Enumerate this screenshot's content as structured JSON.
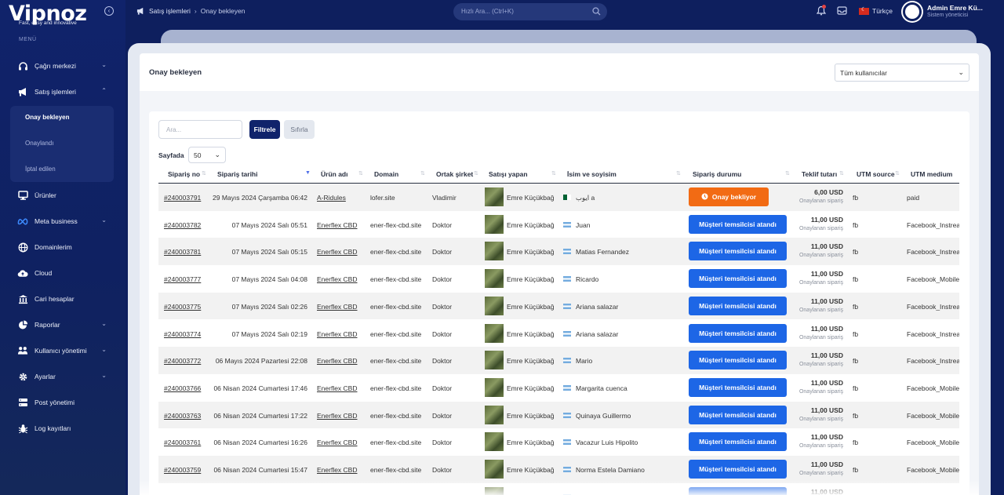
{
  "brand": {
    "name": "Vipnoz",
    "tagline": "Fast, easy and innovative"
  },
  "sidebar": {
    "menu_title": "MENÜ",
    "items": [
      {
        "label": "Çağrı merkezi",
        "icon": "headset-icon",
        "chevron": "⌄"
      },
      {
        "label": "Satış işlemleri",
        "icon": "megaphone-icon",
        "chevron": "⌃"
      },
      {
        "label": "Ürünler",
        "icon": "monitor-icon"
      },
      {
        "label": "Meta business",
        "icon": "meta-icon",
        "chevron": "⌄"
      },
      {
        "label": "Domainlerim",
        "icon": "globe-icon"
      },
      {
        "label": "Cloud",
        "icon": "cloud-icon"
      },
      {
        "label": "Cari hesaplar",
        "icon": "bank-icon"
      },
      {
        "label": "Raporlar",
        "icon": "pie-chart-icon",
        "chevron": "⌄"
      },
      {
        "label": "Kullanıcı yönetimi",
        "icon": "users-icon",
        "chevron": "⌄"
      },
      {
        "label": "Ayarlar",
        "icon": "gear-icon",
        "chevron": "⌄"
      },
      {
        "label": "Post yönetimi",
        "icon": "server-icon"
      },
      {
        "label": "Log kayıtları",
        "icon": "bug-icon"
      }
    ],
    "submenu": [
      "Onay bekleyen",
      "Onaylandı",
      "İptal edilen"
    ]
  },
  "topbar": {
    "breadcrumb": [
      "Satış işlemleri",
      "Onay bekleyen"
    ],
    "breadcrumb_sep": "›",
    "search_placeholder": "Hızlı Ara... (Ctrl+K)",
    "language": "Türkçe",
    "user_name": "Admin Emre Kü...",
    "user_role": "Sistem yöneticisi"
  },
  "page": {
    "title": "Onay bekleyen",
    "user_filter": "Tüm kullanıcılar",
    "search_placeholder": "Ara...",
    "filter_label": "Filtrele",
    "reset_label": "Sıfırla",
    "per_page_label": "Sayfada",
    "per_page_value": "50"
  },
  "table": {
    "columns": [
      "Sipariş no",
      "Sipariş tarihi",
      "Ürün adı",
      "Domain",
      "Ortak şirket",
      "Satışı yapan",
      "İsim ve soyisim",
      "Sipariş durumu",
      "Teklif tutarı",
      "UTM source",
      "UTM medium"
    ],
    "amount_sub": "Onaylanan sipariş",
    "rows": [
      {
        "order": "#240003791",
        "date": "29 Mayıs 2024 Çarşamba 06:42",
        "product": "A-Ridules",
        "domain": "lofer.site",
        "partner": "Vladimir",
        "seller": "Emre Küçükbağ",
        "flag": "dz",
        "customer": "ايوب a",
        "status": "Onay bekliyor",
        "status_type": "orange",
        "amount": "6,00 USD",
        "utm_source": "fb",
        "utm_medium": "paid"
      },
      {
        "order": "#240003782",
        "date": "07 Mayıs 2024 Salı 05:51",
        "product": "Enerflex CBD",
        "domain": "ener-flex-cbd.site",
        "partner": "Doktor",
        "seller": "Emre Küçükbağ",
        "flag": "ar",
        "customer": "Juan",
        "status": "Müşteri temsilcisi atandı",
        "status_type": "blue",
        "amount": "11,00 USD",
        "utm_source": "fb",
        "utm_medium": "Facebook_Instrea"
      },
      {
        "order": "#240003781",
        "date": "07 Mayıs 2024 Salı 05:15",
        "product": "Enerflex CBD",
        "domain": "ener-flex-cbd.site",
        "partner": "Doktor",
        "seller": "Emre Küçükbağ",
        "flag": "ar",
        "customer": "Matias Fernandez",
        "status": "Müşteri temsilcisi atandı",
        "status_type": "blue",
        "amount": "11,00 USD",
        "utm_source": "fb",
        "utm_medium": "Facebook_Instrea"
      },
      {
        "order": "#240003777",
        "date": "07 Mayıs 2024 Salı 04:08",
        "product": "Enerflex CBD",
        "domain": "ener-flex-cbd.site",
        "partner": "Doktor",
        "seller": "Emre Küçükbağ",
        "flag": "ar",
        "customer": "Ricardo",
        "status": "Müşteri temsilcisi atandı",
        "status_type": "blue",
        "amount": "11,00 USD",
        "utm_source": "fb",
        "utm_medium": "Facebook_Mobile"
      },
      {
        "order": "#240003775",
        "date": "07 Mayıs 2024 Salı 02:26",
        "product": "Enerflex CBD",
        "domain": "ener-flex-cbd.site",
        "partner": "Doktor",
        "seller": "Emre Küçükbağ",
        "flag": "ar",
        "customer": "Ariana salazar",
        "status": "Müşteri temsilcisi atandı",
        "status_type": "blue",
        "amount": "11,00 USD",
        "utm_source": "fb",
        "utm_medium": "Facebook_Instrea"
      },
      {
        "order": "#240003774",
        "date": "07 Mayıs 2024 Salı 02:19",
        "product": "Enerflex CBD",
        "domain": "ener-flex-cbd.site",
        "partner": "Doktor",
        "seller": "Emre Küçükbağ",
        "flag": "ar",
        "customer": "Ariana salazar",
        "status": "Müşteri temsilcisi atandı",
        "status_type": "blue",
        "amount": "11,00 USD",
        "utm_source": "fb",
        "utm_medium": "Facebook_Instrea"
      },
      {
        "order": "#240003772",
        "date": "06 Mayıs 2024 Pazartesi 22:08",
        "product": "Enerflex CBD",
        "domain": "ener-flex-cbd.site",
        "partner": "Doktor",
        "seller": "Emre Küçükbağ",
        "flag": "ar",
        "customer": "Mario",
        "status": "Müşteri temsilcisi atandı",
        "status_type": "blue",
        "amount": "11,00 USD",
        "utm_source": "fb",
        "utm_medium": "Facebook_Instrea"
      },
      {
        "order": "#240003766",
        "date": "06 Nisan 2024 Cumartesi 17:46",
        "product": "Enerflex CBD",
        "domain": "ener-flex-cbd.site",
        "partner": "Doktor",
        "seller": "Emre Küçükbağ",
        "flag": "ar",
        "customer": "Margarita cuenca",
        "status": "Müşteri temsilcisi atandı",
        "status_type": "blue",
        "amount": "11,00 USD",
        "utm_source": "fb",
        "utm_medium": "Facebook_Mobile"
      },
      {
        "order": "#240003763",
        "date": "06 Nisan 2024 Cumartesi 17:22",
        "product": "Enerflex CBD",
        "domain": "ener-flex-cbd.site",
        "partner": "Doktor",
        "seller": "Emre Küçükbağ",
        "flag": "ar",
        "customer": "Quinaya Guillermo",
        "status": "Müşteri temsilcisi atandı",
        "status_type": "blue",
        "amount": "11,00 USD",
        "utm_source": "fb",
        "utm_medium": "Facebook_Mobile"
      },
      {
        "order": "#240003761",
        "date": "06 Nisan 2024 Cumartesi 16:26",
        "product": "Enerflex CBD",
        "domain": "ener-flex-cbd.site",
        "partner": "Doktor",
        "seller": "Emre Küçükbağ",
        "flag": "ar",
        "customer": "Vacazur Luis Hipolito",
        "status": "Müşteri temsilcisi atandı",
        "status_type": "blue",
        "amount": "11,00 USD",
        "utm_source": "fb",
        "utm_medium": "Facebook_Mobile"
      },
      {
        "order": "#240003759",
        "date": "06 Nisan 2024 Cumartesi 15:47",
        "product": "Enerflex CBD",
        "domain": "ener-flex-cbd.site",
        "partner": "Doktor",
        "seller": "Emre Küçükbağ",
        "flag": "ar",
        "customer": "Norma Estela Damiano",
        "status": "Müşteri temsilcisi atandı",
        "status_type": "blue",
        "amount": "11,00 USD",
        "utm_source": "fb",
        "utm_medium": "Facebook_Mobile"
      },
      {
        "order": "",
        "date": "",
        "product": "",
        "domain": "",
        "partner": "",
        "seller": "",
        "flag": "ar",
        "customer": "",
        "status": "",
        "status_type": "blue",
        "amount": "11,00 USD",
        "utm_source": "",
        "utm_medium": ""
      }
    ]
  },
  "colors": {
    "sidebar": "#10236b",
    "primary": "#10236b",
    "status_blue": "#1d66e6",
    "status_orange": "#f26b14"
  }
}
